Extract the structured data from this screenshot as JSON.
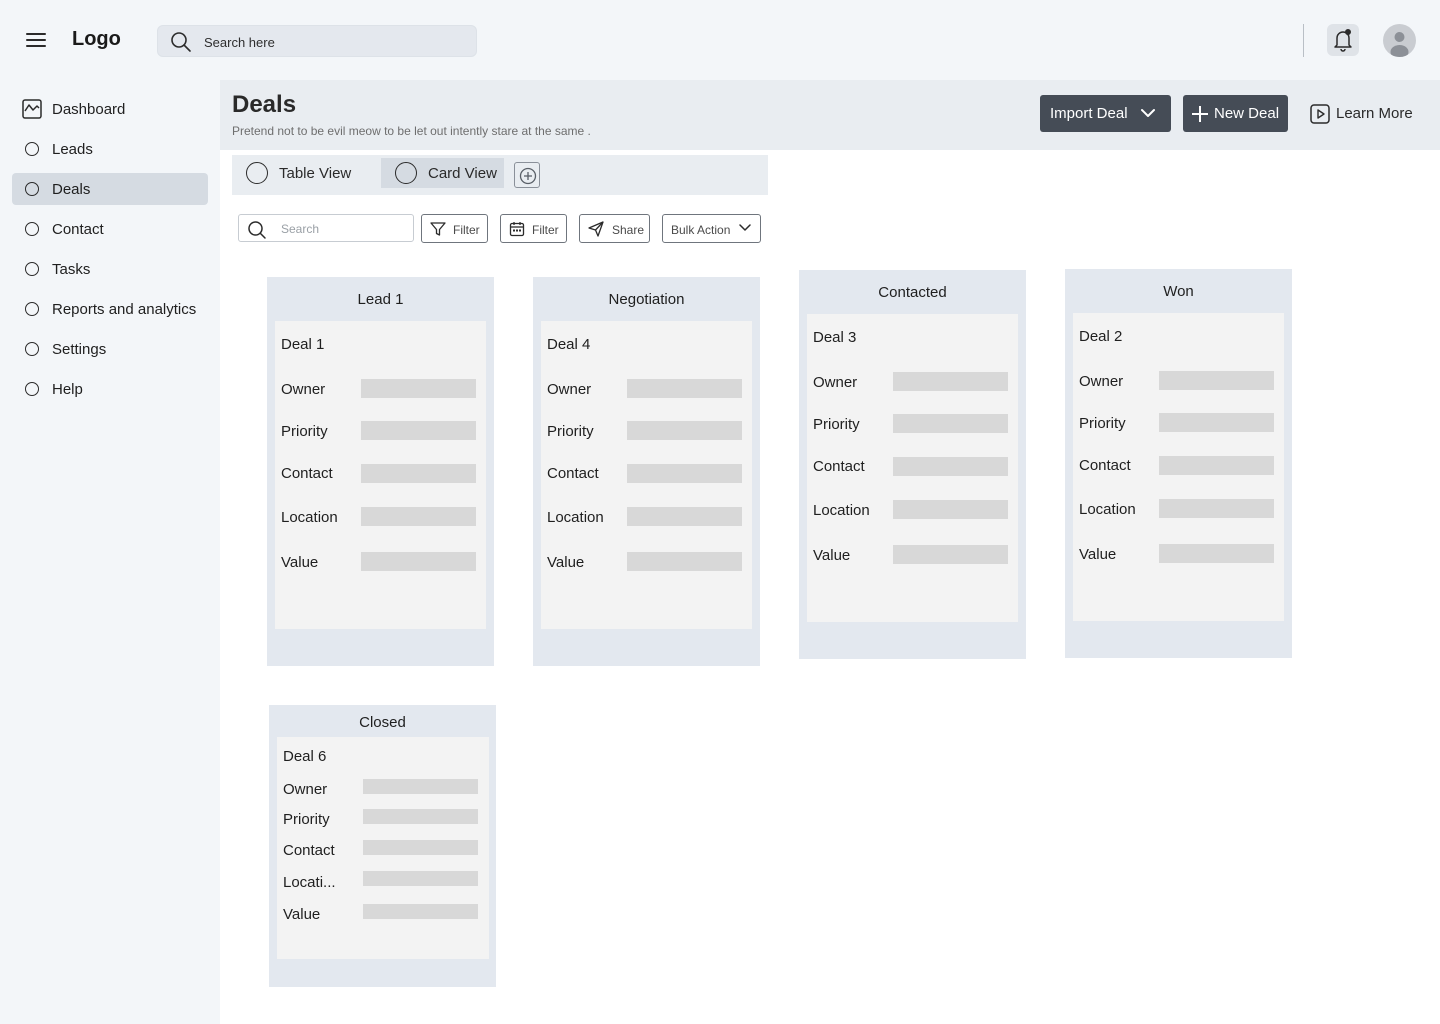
{
  "topbar": {
    "logo": "Logo",
    "search_placeholder": "Search here"
  },
  "sidebar": {
    "items": [
      {
        "label": "Dashboard",
        "icon": "chart-icon"
      },
      {
        "label": "Leads",
        "icon": "circle-icon"
      },
      {
        "label": "Deals",
        "icon": "circle-icon",
        "active": true
      },
      {
        "label": "Contact",
        "icon": "circle-icon"
      },
      {
        "label": "Tasks",
        "icon": "circle-icon"
      },
      {
        "label": "Reports and analytics",
        "icon": "circle-icon"
      },
      {
        "label": "Settings",
        "icon": "circle-icon"
      },
      {
        "label": "Help",
        "icon": "circle-icon"
      }
    ]
  },
  "header": {
    "title": "Deals",
    "subtitle": "Pretend not to be evil meow to be let out intently stare at the same .",
    "import_label": "Import Deal",
    "new_label": "New Deal",
    "learn_label": "Learn More"
  },
  "views": {
    "tabs": [
      {
        "label": "Table View"
      },
      {
        "label": "Card View",
        "active": true
      }
    ]
  },
  "toolbar": {
    "search_placeholder": "Search",
    "filter_label": "Filter",
    "date_filter_label": "Filter",
    "share_label": "Share",
    "bulk_label": "Bulk Action"
  },
  "columns": [
    {
      "title": "Lead 1",
      "card": {
        "title": "Deal 1",
        "fields": [
          "Owner",
          "Priority",
          "Contact",
          "Location",
          "Value"
        ]
      }
    },
    {
      "title": "Negotiation",
      "card": {
        "title": "Deal 4",
        "fields": [
          "Owner",
          "Priority",
          "Contact",
          "Location",
          "Value"
        ]
      }
    },
    {
      "title": "Contacted",
      "card": {
        "title": "Deal 3",
        "fields": [
          "Owner",
          "Priority",
          "Contact",
          "Location",
          "Value"
        ]
      }
    },
    {
      "title": "Won",
      "card": {
        "title": "Deal 2",
        "fields": [
          "Owner",
          "Priority",
          "Contact",
          "Location",
          "Value"
        ]
      }
    },
    {
      "title": "Closed",
      "card": {
        "title": "Deal 6",
        "fields": [
          "Owner",
          "Priority",
          "Contact",
          "Locati...",
          "Value"
        ]
      }
    }
  ],
  "colors": {
    "chrome": "#f3f6f9",
    "header_band": "#e9edf1",
    "active_bg": "#d5dbe2",
    "dark_button": "#454c56",
    "column_bg": "#e3e8ef",
    "card_bg": "#f3f3f3",
    "placeholder_bar": "#d8d8d8"
  }
}
